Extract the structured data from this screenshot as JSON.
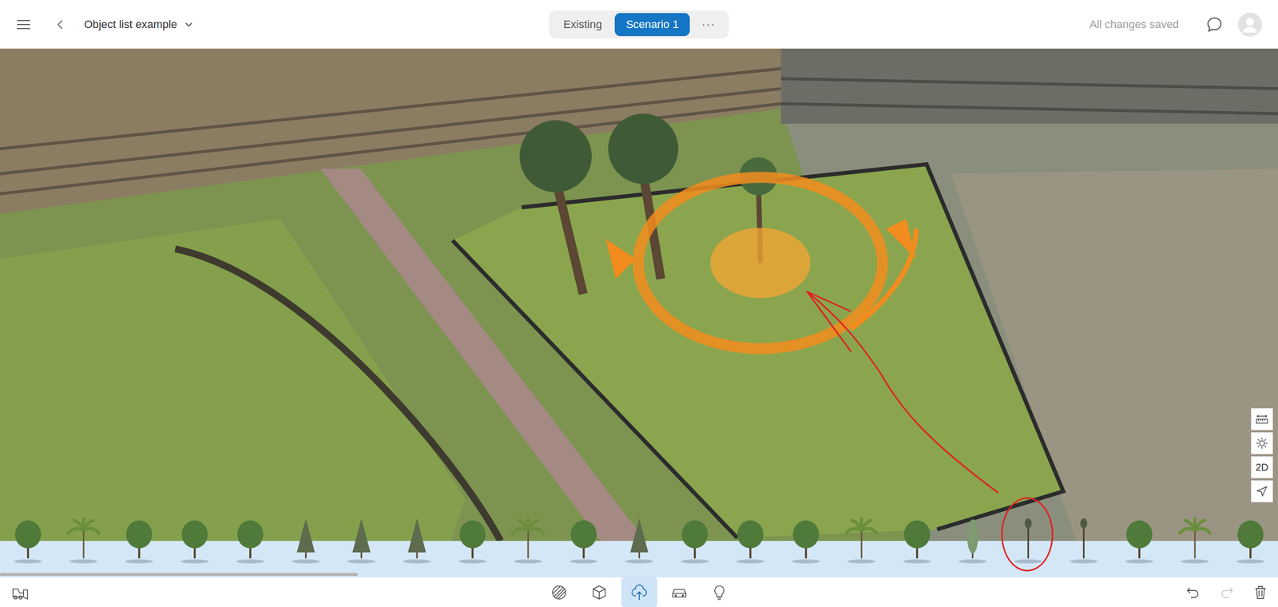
{
  "project": {
    "title": "Object list example"
  },
  "scenarios": [
    {
      "label": "Existing",
      "selected": false
    },
    {
      "label": "Scenario 1",
      "selected": true
    }
  ],
  "more_label": "···",
  "status": "All changes saved",
  "view_tools": [
    {
      "kind": "measure"
    },
    {
      "kind": "sun"
    },
    {
      "kind": "text",
      "label": "2D"
    },
    {
      "kind": "navigate"
    }
  ],
  "object_library": {
    "items": [
      {
        "kind": "broad",
        "annotated": false
      },
      {
        "kind": "palm",
        "annotated": false
      },
      {
        "kind": "broad",
        "annotated": false
      },
      {
        "kind": "broad",
        "annotated": false
      },
      {
        "kind": "broad",
        "annotated": false
      },
      {
        "kind": "conifer",
        "annotated": false
      },
      {
        "kind": "conifer",
        "annotated": false
      },
      {
        "kind": "conifer",
        "annotated": false
      },
      {
        "kind": "broad",
        "annotated": false
      },
      {
        "kind": "palm",
        "annotated": false
      },
      {
        "kind": "broad",
        "annotated": false
      },
      {
        "kind": "conifer",
        "annotated": false
      },
      {
        "kind": "broad",
        "annotated": false
      },
      {
        "kind": "broad",
        "annotated": false
      },
      {
        "kind": "broad",
        "annotated": false
      },
      {
        "kind": "palm",
        "annotated": false
      },
      {
        "kind": "broad",
        "annotated": false
      },
      {
        "kind": "columnar",
        "annotated": false
      },
      {
        "kind": "thin",
        "annotated": true
      },
      {
        "kind": "thin",
        "annotated": false
      },
      {
        "kind": "broad",
        "annotated": false
      },
      {
        "kind": "palm",
        "annotated": false
      },
      {
        "kind": "broad",
        "annotated": false
      }
    ],
    "scroll": {
      "level": 0.28
    }
  },
  "toolbar": {
    "tools": [
      {
        "kind": "areas",
        "selected": false
      },
      {
        "kind": "buildings",
        "selected": false
      },
      {
        "kind": "vegetation",
        "selected": true
      },
      {
        "kind": "vehicles",
        "selected": false
      },
      {
        "kind": "lighting",
        "selected": false
      }
    ],
    "undo": {
      "disabled": false
    },
    "redo": {
      "disabled": true
    }
  }
}
